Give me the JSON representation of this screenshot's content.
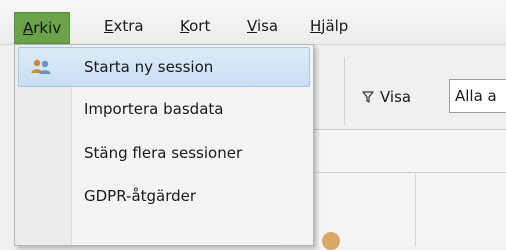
{
  "menubar": {
    "items": [
      {
        "label": "Arkiv",
        "active": true
      },
      {
        "label": "Extra"
      },
      {
        "label": "Kort"
      },
      {
        "label": "Visa"
      },
      {
        "label": "Hjälp"
      }
    ]
  },
  "toolbar": {
    "filter_label": "Visa",
    "filter_value": "Alla a",
    "filter_icon": "funnel-icon"
  },
  "dropdown": {
    "items": [
      {
        "label": "Starta ny session",
        "icon": "users-icon",
        "highlighted": true
      },
      {
        "label": "Importera basdata"
      },
      {
        "label": "Stäng flera sessioner"
      },
      {
        "label": "GDPR-åtgärder"
      }
    ]
  },
  "colors": {
    "menu_active": "#6ba34b",
    "dropdown_highlight": "#cfe3f5",
    "highlight_border": "#a6c8e8"
  }
}
